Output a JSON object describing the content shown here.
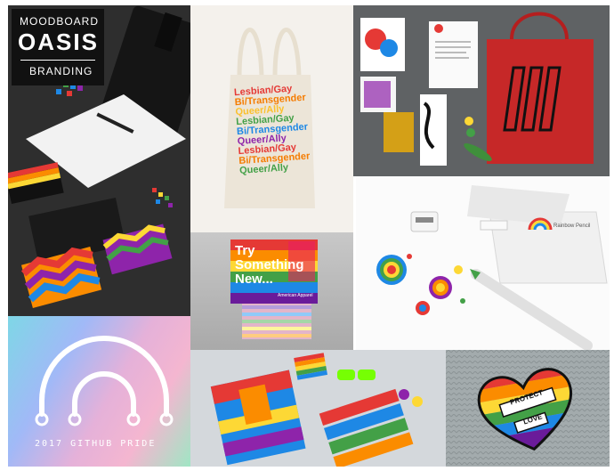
{
  "badge": {
    "line1": "MOODBOARD",
    "line2": "OASIS",
    "line3": "BRANDING"
  },
  "tote": {
    "lines": [
      "Lesbian/Gay",
      "Bi/Transgender",
      "Queer/Ally",
      "Lesbian/Gay",
      "Bi/Transgender",
      "Queer/Ally",
      "Lesbian/Gay",
      "Bi/Transgender",
      "Queer/Ally"
    ],
    "colors": [
      "#e53935",
      "#f57c00",
      "#fbc02d",
      "#43a047",
      "#1e88e5",
      "#8e24aa",
      "#e53935",
      "#f57c00",
      "#43a047"
    ]
  },
  "sign": {
    "line1": "Try",
    "line2": "Something",
    "line3": "New...",
    "brand": "American Apparel"
  },
  "pride": {
    "caption": "2017 GITHUB PRIDE"
  },
  "pin": {
    "word1": "PROTECT",
    "word2": "LOVE"
  },
  "pencil_box": {
    "title": "Rainbow Pencil"
  },
  "colors": {
    "rainbow": [
      "#e53935",
      "#fb8c00",
      "#fdd835",
      "#43a047",
      "#1e88e5",
      "#8e24aa"
    ]
  }
}
